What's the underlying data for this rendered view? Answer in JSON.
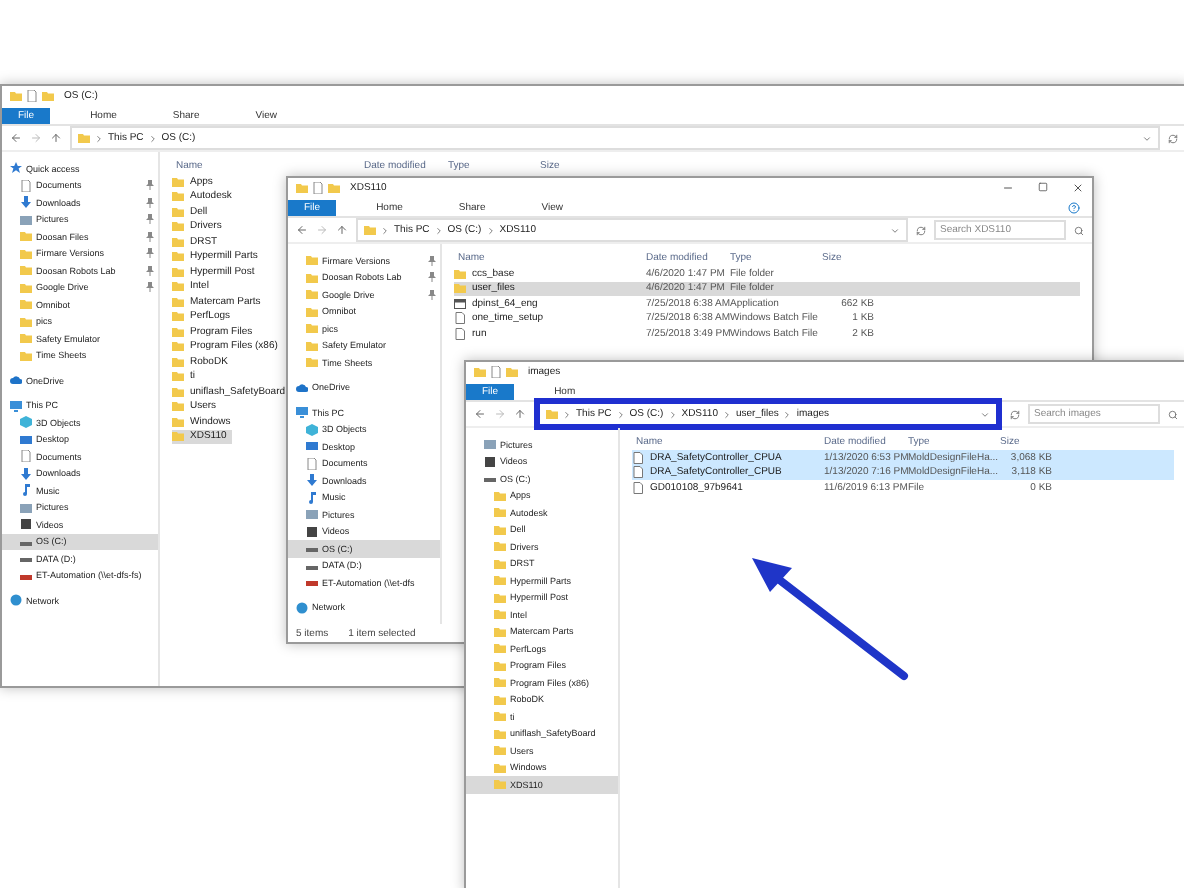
{
  "windows": [
    {
      "title": "OS (C:)",
      "tabs": [
        {
          "label": "File",
          "kind": "menu"
        },
        {
          "label": "Home",
          "kind": "tab"
        },
        {
          "label": "Share",
          "kind": "tab"
        },
        {
          "label": "View",
          "kind": "tab"
        }
      ],
      "address": [
        "This PC",
        "OS (C:)"
      ],
      "columns": [
        "Name",
        "Date modified",
        "Type",
        "Size"
      ],
      "nav": [
        {
          "label": "Quick access",
          "kind": "star",
          "selected": false,
          "children": [
            {
              "label": "Documents",
              "kind": "doc",
              "pinned": true,
              "selected": false
            },
            {
              "label": "Downloads",
              "kind": "download",
              "pinned": true,
              "selected": false
            },
            {
              "label": "Pictures",
              "kind": "picture",
              "pinned": true,
              "selected": false
            },
            {
              "label": "Doosan Files",
              "kind": "folder",
              "pinned": true,
              "selected": false
            },
            {
              "label": "Firmare Versions",
              "kind": "folder",
              "pinned": true,
              "selected": false
            },
            {
              "label": "Doosan Robots Lab",
              "kind": "folder",
              "pinned": true,
              "selected": false
            },
            {
              "label": "Google Drive",
              "kind": "folder",
              "pinned": true,
              "selected": false
            },
            {
              "label": "Omnibot",
              "kind": "folder",
              "pinned": false,
              "selected": false
            },
            {
              "label": "pics",
              "kind": "folder",
              "pinned": false,
              "selected": false
            },
            {
              "label": "Safety Emulator",
              "kind": "folder",
              "pinned": false,
              "selected": false
            },
            {
              "label": "Time Sheets",
              "kind": "folder",
              "pinned": false,
              "selected": false
            }
          ]
        },
        {
          "label": "OneDrive",
          "kind": "cloud",
          "selected": false
        },
        {
          "label": "This PC",
          "kind": "pc",
          "selected": false,
          "children": [
            {
              "label": "3D Objects",
              "kind": "cube",
              "selected": false
            },
            {
              "label": "Desktop",
              "kind": "desktop",
              "selected": false
            },
            {
              "label": "Documents",
              "kind": "doc",
              "selected": false
            },
            {
              "label": "Downloads",
              "kind": "download",
              "selected": false
            },
            {
              "label": "Music",
              "kind": "music",
              "selected": false
            },
            {
              "label": "Pictures",
              "kind": "picture",
              "selected": false
            },
            {
              "label": "Videos",
              "kind": "video",
              "selected": false
            },
            {
              "label": "OS (C:)",
              "kind": "drive",
              "selected": true
            },
            {
              "label": "DATA (D:)",
              "kind": "drive",
              "selected": false
            },
            {
              "label": "ET-Automation (\\\\et-dfs-fs)",
              "kind": "netdrive",
              "selected": false
            }
          ]
        },
        {
          "label": "Network",
          "kind": "network",
          "selected": false
        }
      ],
      "files": [
        {
          "name": "Apps",
          "kind": "folder",
          "selected": false
        },
        {
          "name": "Autodesk",
          "kind": "folder",
          "selected": false
        },
        {
          "name": "Dell",
          "kind": "folder",
          "selected": false
        },
        {
          "name": "Drivers",
          "kind": "folder",
          "selected": false
        },
        {
          "name": "DRST",
          "kind": "folder",
          "selected": false
        },
        {
          "name": "Hypermill Parts",
          "kind": "folder",
          "selected": false
        },
        {
          "name": "Hypermill Post",
          "kind": "folder",
          "selected": false
        },
        {
          "name": "Intel",
          "kind": "folder",
          "selected": false
        },
        {
          "name": "Matercam Parts",
          "kind": "folder",
          "selected": false
        },
        {
          "name": "PerfLogs",
          "kind": "folder",
          "selected": false
        },
        {
          "name": "Program Files",
          "kind": "folder",
          "selected": false
        },
        {
          "name": "Program Files (x86)",
          "kind": "folder",
          "selected": false
        },
        {
          "name": "RoboDK",
          "kind": "folder",
          "selected": false
        },
        {
          "name": "ti",
          "kind": "folder",
          "selected": false
        },
        {
          "name": "uniflash_SafetyBoard",
          "kind": "folder",
          "selected": false
        },
        {
          "name": "Users",
          "kind": "folder",
          "selected": false
        },
        {
          "name": "Windows",
          "kind": "folder",
          "selected": false
        },
        {
          "name": "XDS110",
          "kind": "folder",
          "selected": true
        }
      ]
    },
    {
      "title": "XDS110",
      "controls": true,
      "tabs": [
        {
          "label": "File",
          "kind": "menu"
        },
        {
          "label": "Home",
          "kind": "tab"
        },
        {
          "label": "Share",
          "kind": "tab"
        },
        {
          "label": "View",
          "kind": "tab"
        }
      ],
      "address": [
        "This PC",
        "OS (C:)",
        "XDS110"
      ],
      "search": {
        "placeholder": "Search XDS110"
      },
      "columns": [
        "Name",
        "Date modified",
        "Type",
        "Size"
      ],
      "nav": [
        {
          "children": [
            {
              "label": "Firmare Versions",
              "kind": "folder",
              "pinned": true,
              "selected": false
            },
            {
              "label": "Doosan Robots Lab",
              "kind": "folder",
              "pinned": true,
              "selected": false
            },
            {
              "label": "Google Drive",
              "kind": "folder",
              "pinned": true,
              "selected": false
            },
            {
              "label": "Omnibot",
              "kind": "folder",
              "pinned": false,
              "selected": false
            },
            {
              "label": "pics",
              "kind": "folder",
              "pinned": false,
              "selected": false
            },
            {
              "label": "Safety Emulator",
              "kind": "folder",
              "pinned": false,
              "selected": false
            },
            {
              "label": "Time Sheets",
              "kind": "folder",
              "pinned": false,
              "selected": false
            }
          ]
        },
        {
          "label": "OneDrive",
          "kind": "cloud",
          "selected": false
        },
        {
          "label": "This PC",
          "kind": "pc",
          "selected": false,
          "children": [
            {
              "label": "3D Objects",
              "kind": "cube",
              "selected": false
            },
            {
              "label": "Desktop",
              "kind": "desktop",
              "selected": false
            },
            {
              "label": "Documents",
              "kind": "doc",
              "selected": false
            },
            {
              "label": "Downloads",
              "kind": "download",
              "selected": false
            },
            {
              "label": "Music",
              "kind": "music",
              "selected": false
            },
            {
              "label": "Pictures",
              "kind": "picture",
              "selected": false
            },
            {
              "label": "Videos",
              "kind": "video",
              "selected": false
            },
            {
              "label": "OS (C:)",
              "kind": "drive",
              "selected": true
            },
            {
              "label": "DATA (D:)",
              "kind": "drive",
              "selected": false
            },
            {
              "label": "ET-Automation (\\\\et-dfs",
              "kind": "netdrive",
              "selected": false
            }
          ]
        },
        {
          "label": "Network",
          "kind": "network",
          "selected": false
        }
      ],
      "files": [
        {
          "name": "ccs_base",
          "kind": "folder",
          "date": "4/6/2020 1:47 PM",
          "type": "File folder",
          "selected": false
        },
        {
          "name": "user_files",
          "kind": "folder",
          "date": "4/6/2020 1:47 PM",
          "type": "File folder",
          "selected": true
        },
        {
          "name": "dpinst_64_eng",
          "kind": "app",
          "date": "7/25/2018 6:38 AM",
          "type": "Application",
          "size": "662 KB",
          "selected": false
        },
        {
          "name": "one_time_setup",
          "kind": "file",
          "date": "7/25/2018 6:38 AM",
          "type": "Windows Batch File",
          "size": "1 KB",
          "selected": false
        },
        {
          "name": "run",
          "kind": "file",
          "date": "7/25/2018 3:49 PM",
          "type": "Windows Batch File",
          "size": "2 KB",
          "selected": false
        }
      ],
      "status": [
        "5 items",
        "1 item selected"
      ]
    },
    {
      "title": "images",
      "active": true,
      "address_highlighted": true,
      "tabs": [
        {
          "label": "File",
          "kind": "menu"
        },
        {
          "label": "Hom",
          "kind": "tab"
        }
      ],
      "address": [
        "This PC",
        "OS (C:)",
        "XDS110",
        "user_files",
        "images"
      ],
      "search": {
        "placeholder": "Search images"
      },
      "columns": [
        "Name",
        "Date modified",
        "Type",
        "Size"
      ],
      "nav": [
        {
          "children": [
            {
              "label": "Pictures",
              "kind": "picture",
              "selected": false
            },
            {
              "label": "Videos",
              "kind": "video",
              "selected": false
            },
            {
              "label": "OS (C:)",
              "kind": "drive",
              "selected": false,
              "children": [
                {
                  "label": "Apps",
                  "kind": "folder",
                  "selected": false
                },
                {
                  "label": "Autodesk",
                  "kind": "folder",
                  "selected": false
                },
                {
                  "label": "Dell",
                  "kind": "folder",
                  "selected": false
                },
                {
                  "label": "Drivers",
                  "kind": "folder",
                  "selected": false
                },
                {
                  "label": "DRST",
                  "kind": "folder",
                  "selected": false
                },
                {
                  "label": "Hypermill Parts",
                  "kind": "folder",
                  "selected": false
                },
                {
                  "label": "Hypermill Post",
                  "kind": "folder",
                  "selected": false
                },
                {
                  "label": "Intel",
                  "kind": "folder",
                  "selected": false
                },
                {
                  "label": "Matercam Parts",
                  "kind": "folder",
                  "selected": false
                },
                {
                  "label": "PerfLogs",
                  "kind": "folder",
                  "selected": false
                },
                {
                  "label": "Program Files",
                  "kind": "folder",
                  "selected": false
                },
                {
                  "label": "Program Files (x86)",
                  "kind": "folder",
                  "selected": false
                },
                {
                  "label": "RoboDK",
                  "kind": "folder",
                  "selected": false
                },
                {
                  "label": "ti",
                  "kind": "folder",
                  "selected": false
                },
                {
                  "label": "uniflash_SafetyBoard",
                  "kind": "folder",
                  "selected": false
                },
                {
                  "label": "Users",
                  "kind": "folder",
                  "selected": false
                },
                {
                  "label": "Windows",
                  "kind": "folder",
                  "selected": false
                },
                {
                  "label": "XDS110",
                  "kind": "folder",
                  "selected": true
                }
              ]
            }
          ]
        }
      ],
      "files": [
        {
          "name": "DRA_SafetyController_CPUA",
          "kind": "file",
          "date": "1/13/2020 6:53 PM",
          "type": "MoldDesignFileHa...",
          "size": "3,068 KB",
          "selected": true
        },
        {
          "name": "DRA_SafetyController_CPUB",
          "kind": "file",
          "date": "1/13/2020 7:16 PM",
          "type": "MoldDesignFileHa...",
          "size": "3,118 KB",
          "selected": true
        },
        {
          "name": "GD010108_97b9641",
          "kind": "file",
          "date": "11/6/2019 6:13 PM",
          "type": "File",
          "size": "0 KB",
          "selected": false
        }
      ]
    }
  ],
  "annotations": [
    {
      "kind": "arrow"
    }
  ]
}
